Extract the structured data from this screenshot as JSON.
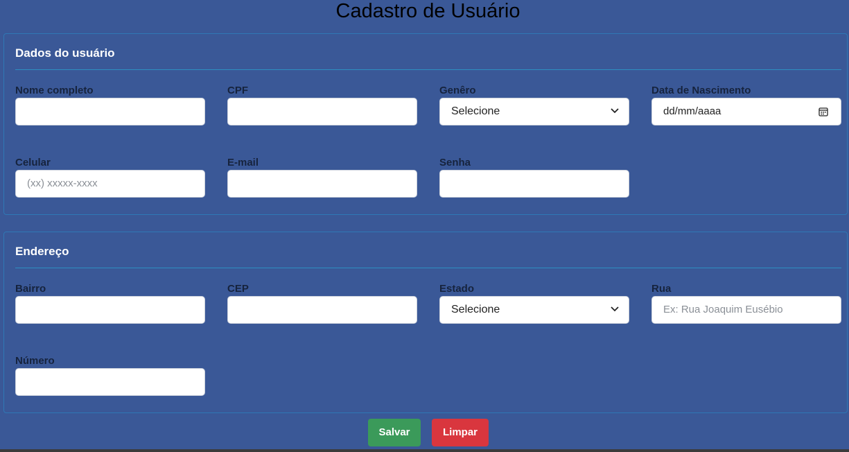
{
  "page": {
    "title": "Cadastro de Usuário"
  },
  "user_section": {
    "title": "Dados do usuário",
    "fields": {
      "nome": {
        "label": "Nome completo",
        "value": "",
        "placeholder": ""
      },
      "cpf": {
        "label": "CPF",
        "value": "",
        "placeholder": ""
      },
      "genero": {
        "label": "Genêro",
        "selected": "Selecione"
      },
      "nascimento": {
        "label": "Data de Nascimento",
        "value": "dd/mm/aaaa"
      },
      "celular": {
        "label": "Celular",
        "placeholder": "(xx) xxxxx-xxxx"
      },
      "email": {
        "label": "E-mail",
        "value": "",
        "placeholder": ""
      },
      "senha": {
        "label": "Senha",
        "value": "",
        "placeholder": ""
      }
    }
  },
  "address_section": {
    "title": "Endereço",
    "fields": {
      "bairro": {
        "label": "Bairro",
        "value": "",
        "placeholder": ""
      },
      "cep": {
        "label": "CEP",
        "value": "",
        "placeholder": ""
      },
      "estado": {
        "label": "Estado",
        "selected": "Selecione"
      },
      "rua": {
        "label": "Rua",
        "placeholder": "Ex: Rua Joaquim Eusébio"
      },
      "numero": {
        "label": "Número",
        "value": "",
        "placeholder": ""
      }
    }
  },
  "actions": {
    "save_label": "Salvar",
    "clear_label": "Limpar"
  },
  "icons": {
    "select": "chevron-down-icon",
    "date": "calendar-icon"
  },
  "colors": {
    "background": "#3a5897",
    "save": "#3b9a5a",
    "clear": "#d9363e",
    "border": "#2f78b5"
  }
}
